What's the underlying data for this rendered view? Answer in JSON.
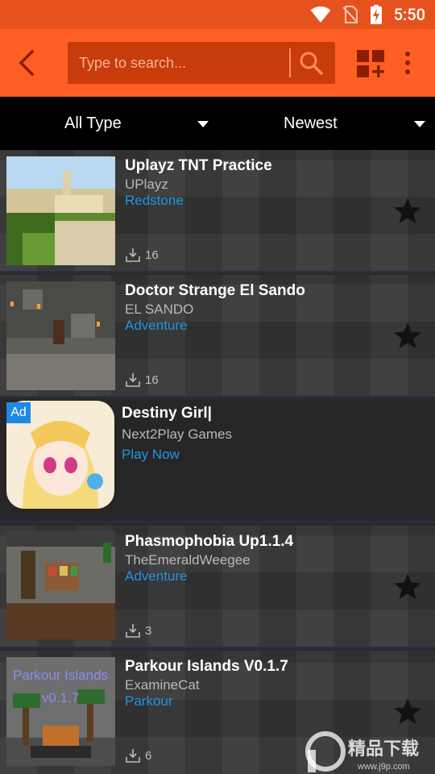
{
  "status_bar": {
    "time": "5:50"
  },
  "toolbar": {
    "search_placeholder": "Type to search..."
  },
  "filters": {
    "type_label": "All Type",
    "sort_label": "Newest"
  },
  "items": [
    {
      "title": "Uplayz TNT Practice",
      "author": "UPlayz",
      "category": "Redstone",
      "downloads": "16"
    },
    {
      "title": "Doctor Strange El Sando",
      "author": "EL SANDO",
      "category": "Adventure",
      "downloads": "16"
    },
    {
      "title": "Phasmophobia Up1.1.4",
      "author": "TheEmeraldWeegee",
      "category": "Adventure",
      "downloads": "3"
    },
    {
      "title": "Parkour Islands V0.1.7",
      "author": "ExamineCat",
      "category": "Parkour",
      "downloads": "6"
    }
  ],
  "ad": {
    "badge": "Ad",
    "title": "Destiny Girl|",
    "publisher": "Next2Play Games",
    "cta": "Play Now"
  },
  "thumbnails": {
    "parkour_line1": "Parkour Islands",
    "parkour_line2": "v0.1.7"
  },
  "watermark": {
    "text": "精品下载",
    "subtext": "www.j9p.com"
  },
  "colors": {
    "toolbar": "#ff5f24",
    "status_bar": "#e5521e",
    "search_bg": "#c83b0a",
    "category_blue": "#2196e3",
    "ad_badge": "#1e88e5"
  }
}
